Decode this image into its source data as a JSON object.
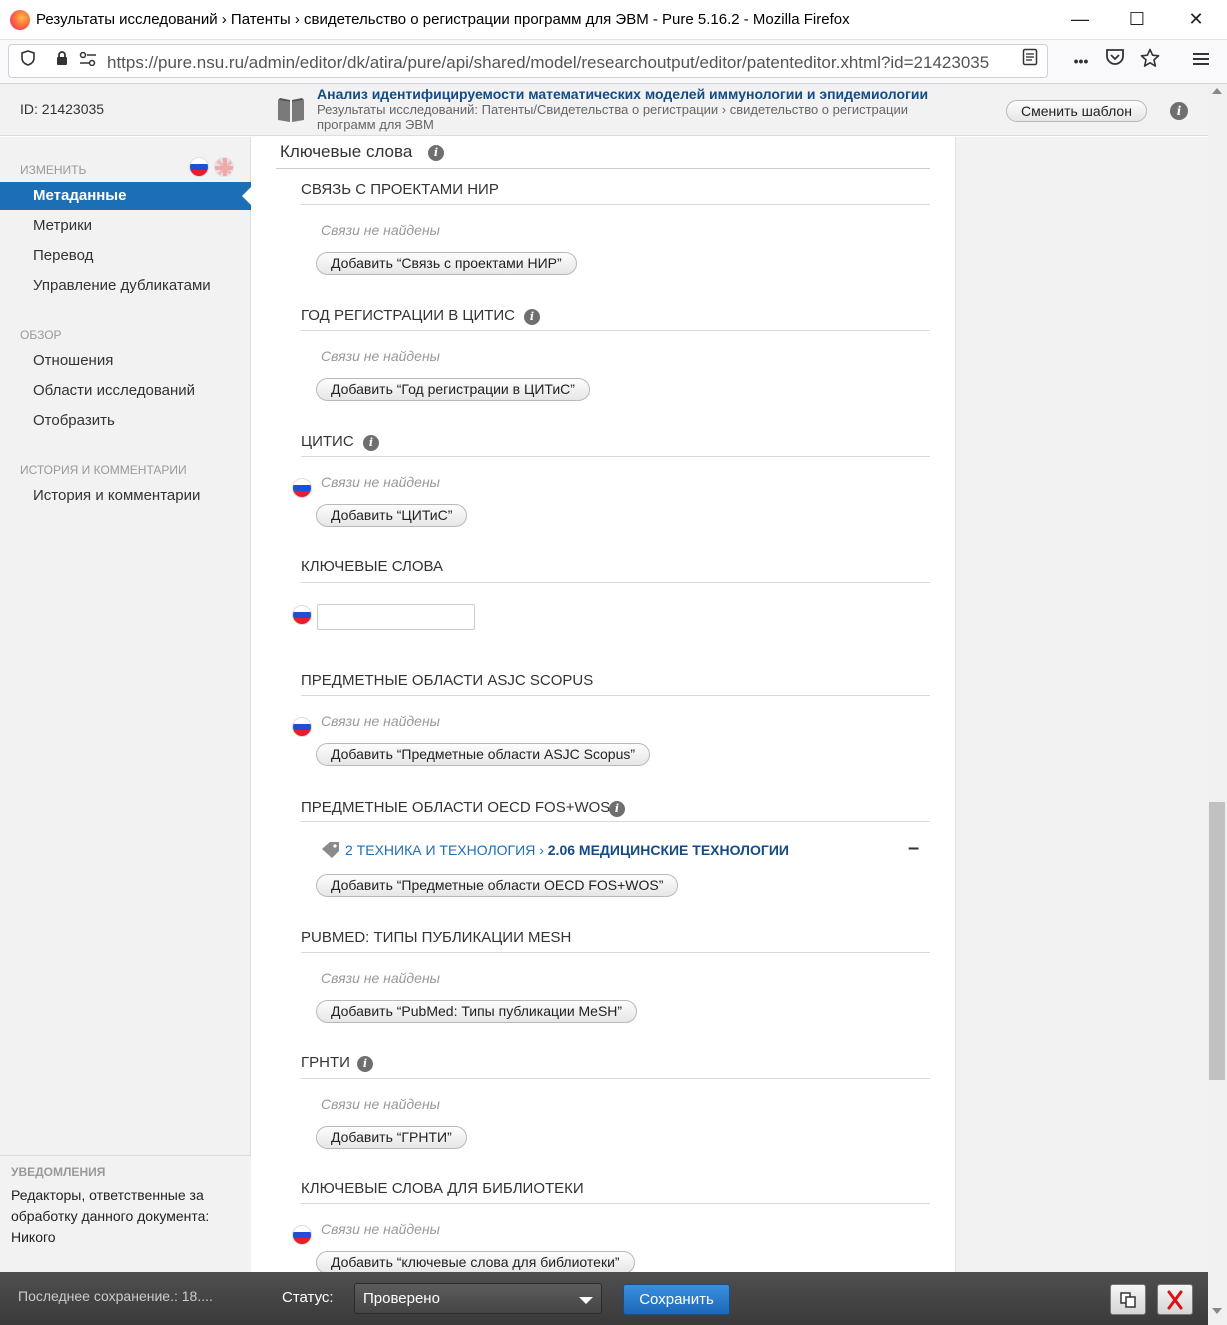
{
  "window": {
    "title": "Результаты исследований › Патенты › свидетельство о регистрации программ для ЭВМ - Pure 5.16.2 - Mozilla Firefox",
    "minimize": "—",
    "maximize": "☐",
    "close": "✕"
  },
  "browser": {
    "url": "https://pure.nsu.ru/admin/editor/dk/atira/pure/api/shared/model/researchoutput/editor/patenteditor.xhtml?id=21423035",
    "more_label": "•••"
  },
  "header": {
    "record_id": "ID: 21423035",
    "title": "Анализ идентифицируемости математических моделей иммунологии и эпидемиологии",
    "subtitle": "Результаты исследований: Патенты/Свидетельства о регистрации › свидетельство о регистрации программ для ЭВМ",
    "change_template": "Сменить шаблон"
  },
  "sidebar": {
    "edit_heading": "Изменить",
    "edit_items": [
      "Метаданные",
      "Метрики",
      "Перевод",
      "Управление дубликатами"
    ],
    "overview_heading": "Обзор",
    "overview_items": [
      "Отношения",
      "Области исследований",
      "Отобразить"
    ],
    "history_heading": "История и комментарии",
    "history_items": [
      "История и комментарии"
    ]
  },
  "notifications": {
    "heading": "Уведомления",
    "text": "Редакторы, ответственные за обработку данного документа: Никого"
  },
  "main": {
    "heading": "Ключевые слова",
    "sections": [
      {
        "title": "Связь с проектами НИР",
        "empty": "Связи не найдены",
        "button": "Добавить “Связь с проектами НИР”"
      },
      {
        "title": "Год регистрации в ЦИТИС",
        "empty": "Связи не найдены",
        "button": "Добавить “Год регистрации в ЦИТиС”"
      },
      {
        "title": "ЦИТИС",
        "empty": "Связи не найдены",
        "button": "Добавить “ЦИТиС”"
      },
      {
        "title": "Ключевые слова",
        "input_value": ""
      },
      {
        "title": "Предметные области ASJC Scopus",
        "empty": "Связи не найдены",
        "button": "Добавить “Предметные области ASJC Scopus”"
      },
      {
        "title": "Предметные области OECD FOS+WOS",
        "button": "Добавить “Предметные области OECD FOS+WOS”"
      },
      {
        "title": "PubMed: Типы публикации MeSH",
        "empty": "Связи не найдены",
        "button": "Добавить “PubMed: Типы публикации MeSH”"
      },
      {
        "title": "ГРНТИ",
        "empty": "Связи не найдены",
        "button": "Добавить “ГРНТИ”"
      },
      {
        "title": "Ключевые слова для библиотеки",
        "empty": "Связи не найдены",
        "button": "Добавить “ключевые слова для библиотеки”"
      }
    ],
    "oecd_item": {
      "parent": "2 ТЕХНИКА И ТЕХНОЛОГИЯ",
      "separator": "›",
      "child": "2.06 МЕДИЦИНСКИЕ ТЕХНОЛОГИИ",
      "remove": "–"
    }
  },
  "footer": {
    "last_saved": "Последнее сохранение.: 18....",
    "status_label": "Статус:",
    "status_value": "Проверено",
    "save": "Сохранить"
  },
  "colors": {
    "accent": "#1c6fb5",
    "title_blue": "#144a86",
    "bottom_bar": "#3f3f3f",
    "cancel_red": "#d11"
  }
}
